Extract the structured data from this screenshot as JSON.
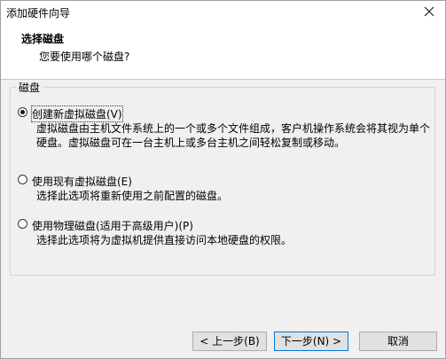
{
  "window": {
    "title": "添加硬件向导"
  },
  "header": {
    "title": "选择磁盘",
    "subtitle": "您要使用哪个磁盘?"
  },
  "group": {
    "label": "磁盘",
    "options": [
      {
        "label": "创建新虚拟磁盘(V)",
        "description": "虚拟磁盘由主机文件系统上的一个或多个文件组成，客户机操作系统会将其视为单个硬盘。虚拟磁盘可在一台主机上或多台主机之间轻松复制或移动。",
        "selected": true
      },
      {
        "label": "使用现有虚拟磁盘(E)",
        "description": "选择此选项将重新使用之前配置的磁盘。",
        "selected": false
      },
      {
        "label": "使用物理磁盘(适用于高级用户)(P)",
        "description": "选择此选项将为虚拟机提供直接访问本地硬盘的权限。",
        "selected": false
      }
    ]
  },
  "buttons": {
    "back": "< 上一步(B)",
    "next": "下一步(N) >",
    "cancel": "取消"
  }
}
